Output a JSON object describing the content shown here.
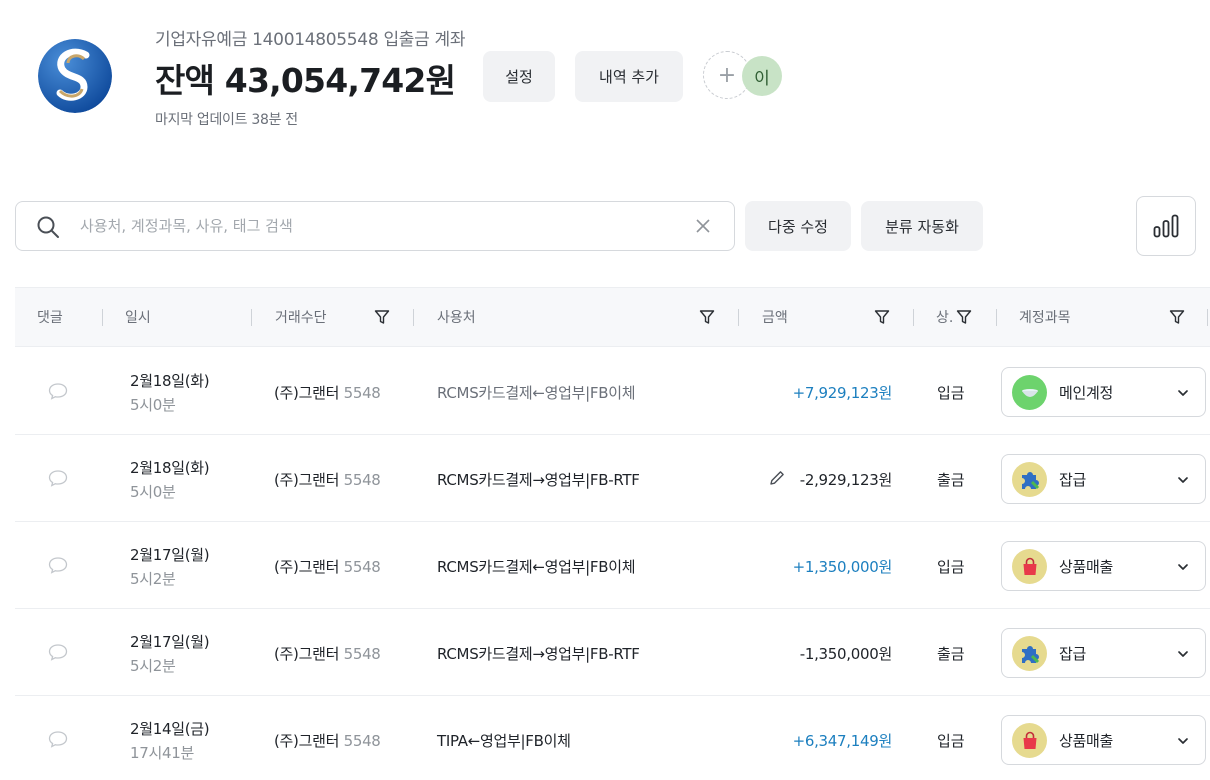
{
  "header": {
    "account_name": "기업자유예금 140014805548 입출금 계좌",
    "balance": "잔액 43,054,742원",
    "last_update": "마지막 업데이트 38분 전",
    "settings_label": "설정",
    "add_history_label": "내역 추가",
    "invite_symbol": "+",
    "avatar_initial": "이"
  },
  "toolbar": {
    "search_placeholder": "사용처, 계정과목, 사유, 태그 검색",
    "multi_edit_label": "다중 수정",
    "auto_classify_label": "분류 자동화"
  },
  "table": {
    "columns": [
      "댓글",
      "일시",
      "거래수단",
      "사용처",
      "금액",
      "상.",
      "계정과목"
    ],
    "rows": [
      {
        "date": "2월18일(화)",
        "time": "5시0분",
        "method": "(주)그랜터",
        "card": "5548",
        "merchant": "RCMS카드결제←영업부|FB이체",
        "amount": "+7,929,123원",
        "direction": "in",
        "status": "입금",
        "account": "메인계정",
        "account_icon": "bowl-icon",
        "edit": false
      },
      {
        "date": "2월18일(화)",
        "time": "5시0분",
        "method": "(주)그랜터",
        "card": "5548",
        "merchant": "RCMS카드결제→영업부|FB-RTF",
        "amount": "-2,929,123원",
        "direction": "out",
        "status": "출금",
        "account": "잡급",
        "account_icon": "puzzle-icon",
        "edit": true
      },
      {
        "date": "2월17일(월)",
        "time": "5시2분",
        "method": "(주)그랜터",
        "card": "5548",
        "merchant": "RCMS카드결제←영업부|FB이체",
        "amount": "+1,350,000원",
        "direction": "in",
        "status": "입금",
        "account": "상품매출",
        "account_icon": "shopping-bag-icon",
        "edit": false
      },
      {
        "date": "2월17일(월)",
        "time": "5시2분",
        "method": "(주)그랜터",
        "card": "5548",
        "merchant": "RCMS카드결제→영업부|FB-RTF",
        "amount": "-1,350,000원",
        "direction": "out",
        "status": "출금",
        "account": "잡급",
        "account_icon": "puzzle-icon",
        "edit": false
      },
      {
        "date": "2월14일(금)",
        "time": "17시41분",
        "method": "(주)그랜터",
        "card": "5548",
        "merchant": "TIPA←영업부|FB이체",
        "amount": "+6,347,149원",
        "direction": "in",
        "status": "입금",
        "account": "상품매출",
        "account_icon": "shopping-bag-icon",
        "edit": false
      }
    ]
  },
  "colors": {
    "accent_in": "#1c7fbf",
    "avatar_bg": "#c8e3c6",
    "bowl_bg": "#6dd36d",
    "puzzle_bg": "#e6da8f",
    "bag_bg": "#e6da8f"
  }
}
